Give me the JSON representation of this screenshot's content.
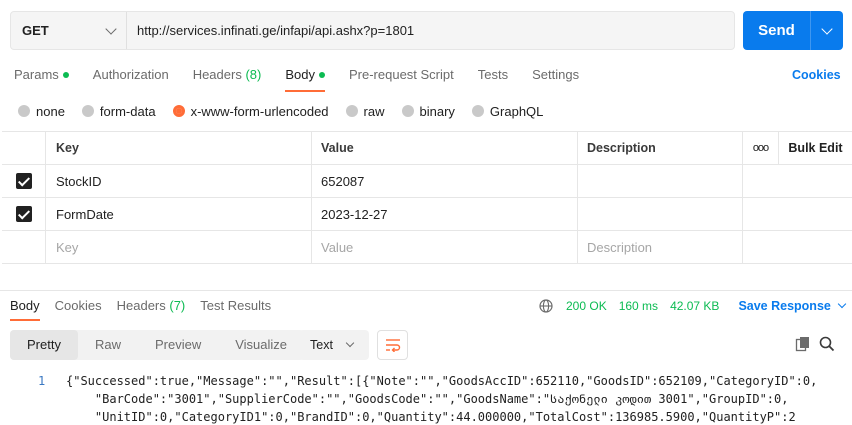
{
  "request": {
    "method": "GET",
    "url": "http://services.infinati.ge/infapi/api.ashx?p=1801",
    "send_label": "Send"
  },
  "request_tabs": [
    {
      "label": "Params",
      "dot": true
    },
    {
      "label": "Authorization"
    },
    {
      "label": "Headers",
      "count": "(8)"
    },
    {
      "label": "Body",
      "dot": true,
      "active": true
    },
    {
      "label": "Pre-request Script"
    },
    {
      "label": "Tests"
    },
    {
      "label": "Settings"
    }
  ],
  "cookies_label": "Cookies",
  "body_types": [
    {
      "label": "none"
    },
    {
      "label": "form-data"
    },
    {
      "label": "x-www-form-urlencoded",
      "selected": true
    },
    {
      "label": "raw"
    },
    {
      "label": "binary"
    },
    {
      "label": "GraphQL"
    }
  ],
  "params_table": {
    "headers": {
      "key": "Key",
      "value": "Value",
      "description": "Description",
      "bulk_edit": "Bulk Edit",
      "more": "ooo"
    },
    "rows": [
      {
        "checked": true,
        "key": "StockID",
        "value": "652087",
        "description": ""
      },
      {
        "checked": true,
        "key": "FormDate",
        "value": "2023-12-27",
        "description": ""
      }
    ],
    "placeholders": {
      "key": "Key",
      "value": "Value",
      "description": "Description"
    }
  },
  "response_tabs": [
    {
      "label": "Body",
      "active": true
    },
    {
      "label": "Cookies"
    },
    {
      "label": "Headers",
      "count": "(7)"
    },
    {
      "label": "Test Results"
    }
  ],
  "response_stats": {
    "status": "200 OK",
    "time": "160 ms",
    "size": "42.07 KB",
    "save_label": "Save Response"
  },
  "view_modes": [
    "Pretty",
    "Raw",
    "Preview",
    "Visualize"
  ],
  "format_label": "Text",
  "code": {
    "line_number": "1",
    "lines": [
      "{\"Successed\":true,\"Message\":\"\",\"Result\":[{\"Note\":\"\",\"GoodsAccID\":652110,\"GoodsID\":652109,\"CategoryID\":0,",
      "    \"BarCode\":\"3001\",\"SupplierCode\":\"\",\"GoodsCode\":\"\",\"GoodsName\":\"საქონელი კოდით 3001\",\"GroupID\":0,",
      "    \"UnitID\":0,\"CategoryID1\":0,\"BrandID\":0,\"Quantity\":44.000000,\"TotalCost\":136985.5900,\"QuantityP\":2"
    ]
  },
  "colors": {
    "accent": "#ff6c37",
    "primary": "#097bed",
    "success": "#0cbb52"
  }
}
